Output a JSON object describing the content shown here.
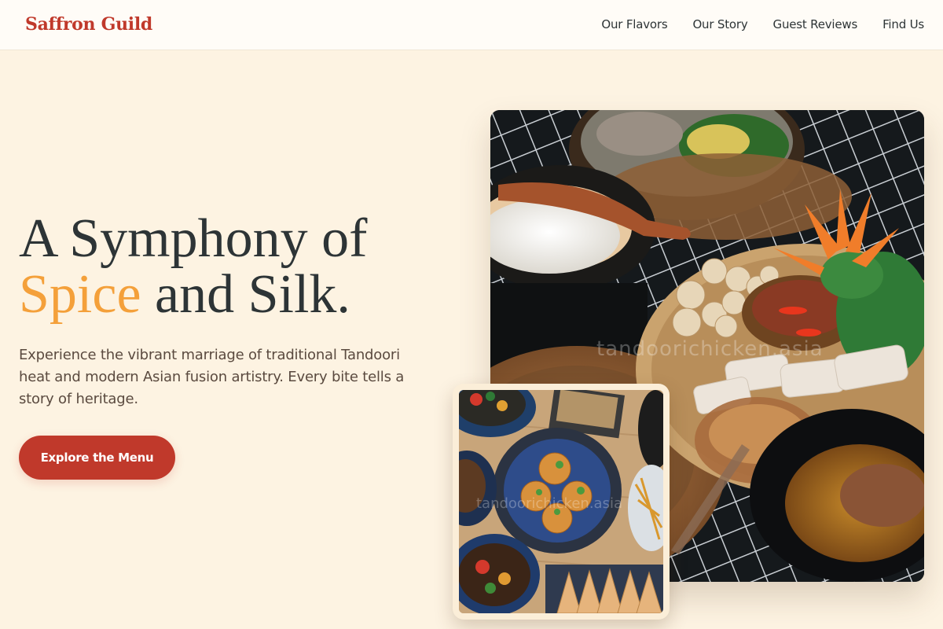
{
  "brand": {
    "name": "Saffron Guild"
  },
  "nav": {
    "items": [
      {
        "label": "Our Flavors"
      },
      {
        "label": "Our Story"
      },
      {
        "label": "Guest Reviews"
      },
      {
        "label": "Find Us"
      }
    ]
  },
  "hero": {
    "title_line1": "A Symphony of",
    "title_accent": "Spice",
    "title_line2_rest": " and Silk.",
    "description": "Experience the vibrant marriage of traditional Tandoori heat and modern Asian fusion artistry. Every bite tells a story of heritage.",
    "cta_label": "Explore the Menu"
  },
  "images": {
    "main_watermark": "tandoorichicken.asia",
    "overlay_watermark": "tandoorichicken.asia"
  },
  "colors": {
    "background": "#fdf3e2",
    "brand": "#c0392b",
    "accent": "#f4a03a",
    "text": "#2d3436"
  }
}
